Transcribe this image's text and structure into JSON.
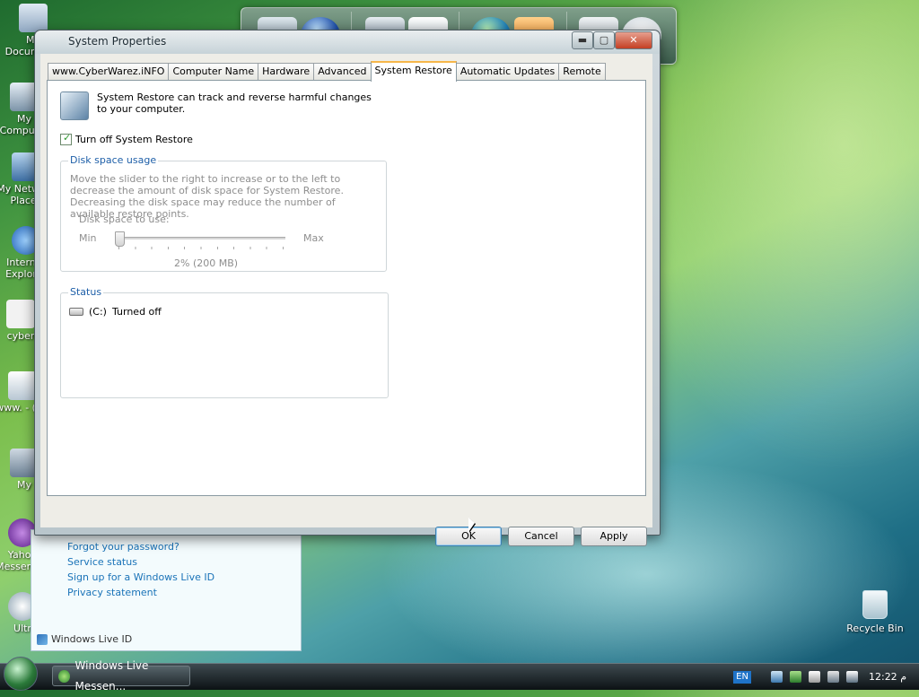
{
  "desktop": {
    "icons": [
      {
        "label": "My Documents"
      },
      {
        "label": "My Computer"
      },
      {
        "label": "My Network Places"
      },
      {
        "label": "Internet Explorer"
      },
      {
        "label": "cyber"
      },
      {
        "label": "www. - (YO"
      },
      {
        "label": "My"
      },
      {
        "label": "Yahoo Messenger"
      },
      {
        "label": "Ultr"
      }
    ],
    "recycle_bin": {
      "label": "Recycle Bin"
    }
  },
  "live_window": {
    "links": [
      {
        "label": "Forgot your password?"
      },
      {
        "label": "Service status"
      },
      {
        "label": "Sign up for a Windows Live ID"
      },
      {
        "label": "Privacy statement"
      }
    ],
    "footer": "Windows Live ID"
  },
  "dialog": {
    "title": "System Properties",
    "controls": {
      "minimize": "▬",
      "maximize": "▢",
      "close": "✕"
    },
    "tabs": [
      {
        "label": "www.CyberWarez.iNFO"
      },
      {
        "label": "Computer Name"
      },
      {
        "label": "Hardware"
      },
      {
        "label": "Advanced"
      },
      {
        "label": "System Restore",
        "active": true
      },
      {
        "label": "Automatic Updates"
      },
      {
        "label": "Remote"
      }
    ],
    "intro": "System Restore can track and reverse harmful changes to your computer.",
    "turn_off_checkbox": {
      "label": "Turn off System Restore",
      "checked": true
    },
    "disk_space": {
      "group_title": "Disk space usage",
      "description": "Move the slider to the right to increase or to the left to decrease the amount of disk space for System Restore. Decreasing the disk space may reduce the number of available restore points.",
      "slider_label": "Disk space to use:",
      "min_label": "Min",
      "max_label": "Max",
      "value_text": "2% (200 MB)",
      "value_fraction": 0.0
    },
    "status": {
      "group_title": "Status",
      "drives": [
        {
          "drive": "(C:)",
          "state": "Turned off"
        }
      ]
    },
    "buttons": {
      "ok": "OK",
      "cancel": "Cancel",
      "apply": "Apply"
    }
  },
  "taskbar": {
    "task_button": "Windows Live Messen...",
    "language": "EN",
    "clock": "12:22 م"
  },
  "colors": {
    "link": "#1a73b8",
    "group_title": "#1e5fa8",
    "active_tab_accent": "#f6b74a"
  }
}
